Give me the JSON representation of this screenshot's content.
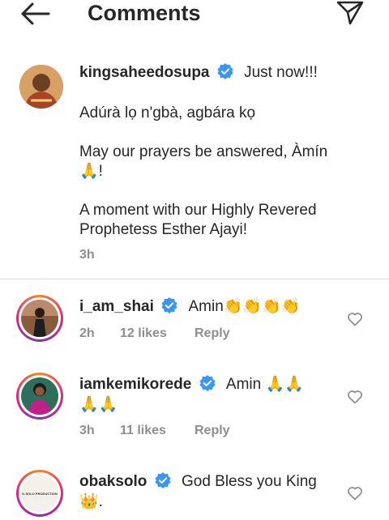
{
  "header": {
    "title": "Comments"
  },
  "caption": {
    "username": "kingsaheedosupa",
    "time_inline": "Just now!!!",
    "lines": [
      "Adúrà lọ n'gbà, agbára kọ",
      "May our prayers be answered, Àmín",
      "🙏!",
      "A moment with our Highly Revered",
      "Prophetess Esther Ajayi!"
    ],
    "age": "3h"
  },
  "comments": [
    {
      "username": "i_am_shai",
      "text": "Amin👏👏👏👏",
      "age": "2h",
      "likes": "12 likes",
      "reply": "Reply"
    },
    {
      "username": "iamkemikorede",
      "text": "Amin 🙏🙏",
      "text2": "🙏🙏",
      "age": "3h",
      "likes": "11 likes",
      "reply": "Reply"
    },
    {
      "username": "obaksolo",
      "text": "God Bless you King",
      "text2": "👑.",
      "avatar_text": "K-SOLO PRODUCTION"
    }
  ],
  "colors": {
    "verified": "#3897f0",
    "meta": "#8e8e8e",
    "divider": "#dbdbdb"
  },
  "icons": [
    "back-arrow-icon",
    "send-icon",
    "verified-badge-icon",
    "heart-icon"
  ]
}
